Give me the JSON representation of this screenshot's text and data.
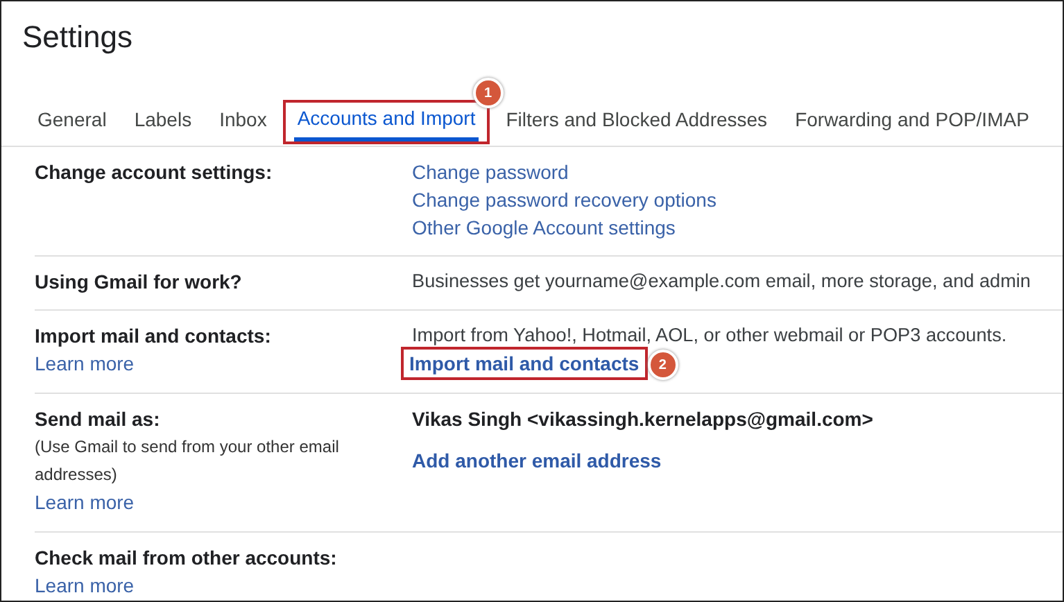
{
  "title": "Settings",
  "tabs": [
    {
      "label": "General",
      "selected": false
    },
    {
      "label": "Labels",
      "selected": false
    },
    {
      "label": "Inbox",
      "selected": false
    },
    {
      "label": "Accounts and Import",
      "selected": true,
      "callout": "1"
    },
    {
      "label": "Filters and Blocked Addresses",
      "selected": false
    },
    {
      "label": "Forwarding and POP/IMAP",
      "selected": false
    }
  ],
  "sections": [
    {
      "label": "Change account settings:",
      "items": [
        {
          "kind": "link",
          "text": "Change password"
        },
        {
          "kind": "link",
          "text": "Change password recovery options"
        },
        {
          "kind": "link",
          "text": "Other Google Account settings"
        }
      ]
    },
    {
      "label": "Using Gmail for work?",
      "items": [
        {
          "kind": "text",
          "text": "Businesses get yourname@example.com email, more storage, and admin"
        }
      ]
    },
    {
      "label": "Import mail and contacts:",
      "learn_more": "Learn more",
      "items": [
        {
          "kind": "text",
          "text": "Import from Yahoo!, Hotmail, AOL, or other webmail or POP3 accounts."
        },
        {
          "kind": "button-link",
          "text": "Import mail and contacts",
          "callout": "2"
        }
      ]
    },
    {
      "label": "Send mail as:",
      "note": "(Use Gmail to send from your other email addresses)",
      "learn_more": "Learn more",
      "items": [
        {
          "kind": "bold",
          "text": "Vikas Singh <vikassingh.kernelapps@gmail.com>"
        },
        {
          "kind": "button-link",
          "text": "Add another email address"
        }
      ]
    },
    {
      "label": "Check mail from other accounts:",
      "learn_more": "Learn more"
    }
  ]
}
